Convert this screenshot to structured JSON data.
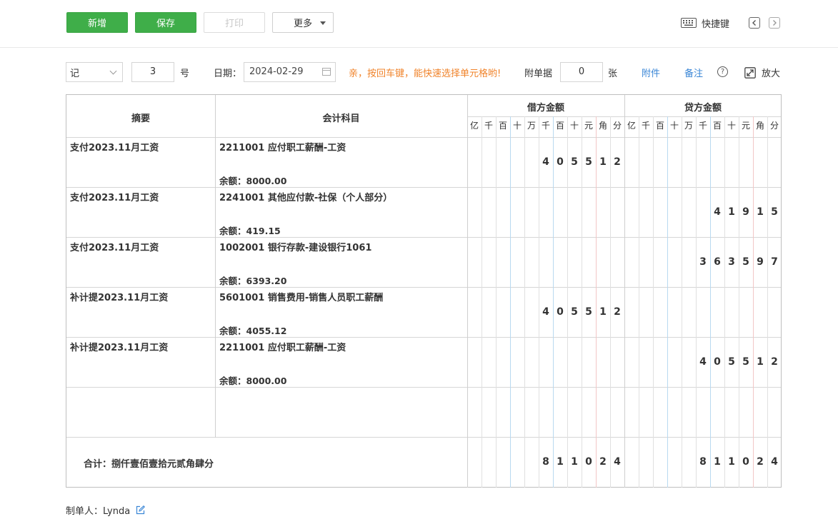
{
  "toolbar": {
    "new_label": "新增",
    "save_label": "保存",
    "print_label": "打印",
    "more_label": "更多",
    "shortcut_label": "快捷键"
  },
  "header": {
    "voucher_type": "记",
    "voucher_number": "3",
    "number_suffix": "号",
    "date_label": "日期：",
    "date_value": "2024-02-29",
    "tip": "亲，按回车键，能快速选择单元格哟!",
    "attachments_label": "附单据",
    "attachments_count": "0",
    "attachments_unit": "张",
    "attach_link": "附件",
    "remark_link": "备注",
    "help_symbol": "?",
    "zoom_label": "放大"
  },
  "table": {
    "col_summary": "摘要",
    "col_account": "会计科目",
    "col_debit": "借方金额",
    "col_credit": "贷方金额",
    "units": [
      "亿",
      "千",
      "百",
      "十",
      "万",
      "千",
      "百",
      "十",
      "元",
      "角",
      "分"
    ],
    "balance_prefix": "余额：",
    "rows": [
      {
        "summary": "支付2023.11月工资",
        "account": "2211001 应付职工薪酬-工资",
        "balance": "余额：8000.00",
        "debit": "405512",
        "credit": ""
      },
      {
        "summary": "支付2023.11月工资",
        "account": "2241001 其他应付款-社保（个人部分）",
        "balance": "余额：419.15",
        "debit": "",
        "credit": "41915"
      },
      {
        "summary": "支付2023.11月工资",
        "account": "1002001 银行存款-建设银行1061",
        "balance": "余额：6393.20",
        "debit": "",
        "credit": "363597"
      },
      {
        "summary": "补计提2023.11月工资",
        "account": "5601001 销售费用-销售人员职工薪酬",
        "balance": "余额：4055.12",
        "debit": "405512",
        "credit": ""
      },
      {
        "summary": "补计提2023.11月工资",
        "account": "2211001 应付职工薪酬-工资",
        "balance": "余额：8000.00",
        "debit": "",
        "credit": "405512"
      },
      {
        "summary": "",
        "account": "",
        "balance": "",
        "debit": "",
        "credit": ""
      }
    ],
    "total_text": "合计：捌仟壹佰壹拾元贰角肆分",
    "total_debit": "811024",
    "total_credit": "811024"
  },
  "footer": {
    "creator": "制单人：Lynda"
  }
}
